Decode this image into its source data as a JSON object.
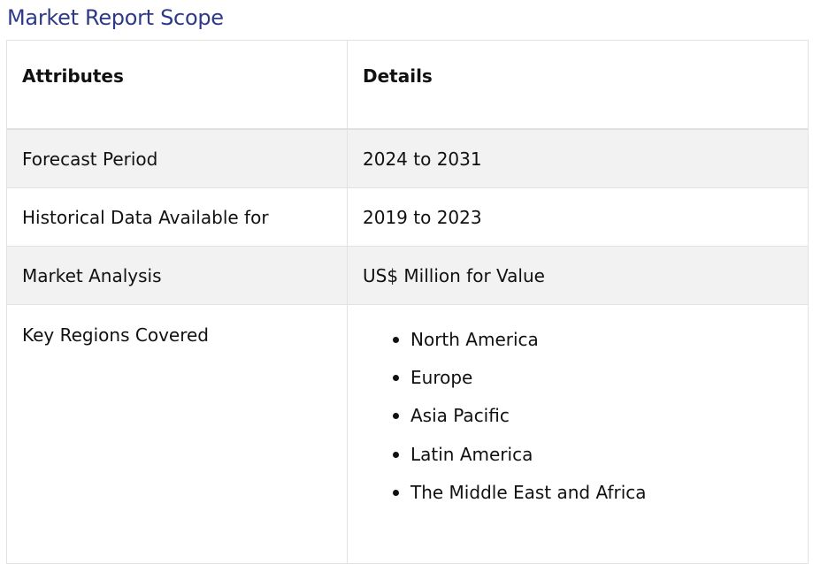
{
  "title": "Market Report Scope",
  "table": {
    "headers": {
      "attributes": "Attributes",
      "details": "Details"
    },
    "rows": [
      {
        "attribute": "Forecast Period",
        "detail": "2024 to 2031"
      },
      {
        "attribute": "Historical Data Available for",
        "detail": "2019 to 2023"
      },
      {
        "attribute": "Market Analysis",
        "detail": "US$ Million for Value"
      },
      {
        "attribute": "Key Regions Covered",
        "regions": [
          "North America",
          "Europe",
          "Asia Pacific",
          "Latin America",
          "The Middle East and Africa"
        ]
      }
    ]
  }
}
